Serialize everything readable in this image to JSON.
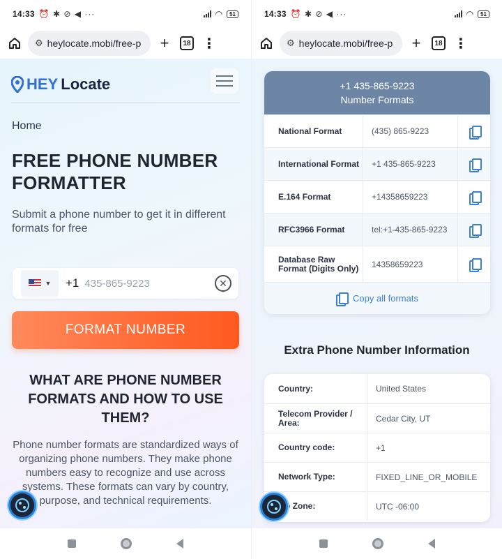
{
  "status_bar": {
    "time": "14:33",
    "status_icons": "⏰ ✱ ⊘ ◀ ···",
    "battery": "51"
  },
  "browser": {
    "url": "heylocate.mobi/free-p",
    "tab_count": "18"
  },
  "left": {
    "logo_prefix": "HEY",
    "logo_suffix": "Locate",
    "breadcrumb": "Home",
    "title": "FREE PHONE NUMBER FORMATTER",
    "subtitle": "Submit a phone number to get it in different formats for free",
    "country_code": "+1",
    "phone_placeholder": "435-865-9223",
    "format_button": "FORMAT NUMBER",
    "section_title": "WHAT ARE PHONE NUMBER FORMATS AND HOW TO USE THEM?",
    "section_text": "Phone number formats are standardized ways of organizing phone numbers. They make phone numbers easy to recognize and use across systems. These formats can vary by country, purpose, and technical requirements."
  },
  "right": {
    "formats_header_number": "+1 435-865-9223",
    "formats_header_title": "Number Formats",
    "formats": [
      {
        "label": "National Format",
        "value": "(435) 865-9223"
      },
      {
        "label": "International Format",
        "value": "+1 435-865-9223"
      },
      {
        "label": "E.164 Format",
        "value": "+14358659223"
      },
      {
        "label": "RFC3966 Format",
        "value": "tel:+1-435-865-9223"
      },
      {
        "label": "Database Raw Format (Digits Only)",
        "value": "14358659223"
      }
    ],
    "copy_all": "Copy all formats",
    "extra_title": "Extra Phone Number Information",
    "info": [
      {
        "label": "Country:",
        "value": "United States"
      },
      {
        "label": "Telecom Provider / Area:",
        "value": "Cedar City, UT"
      },
      {
        "label": "Country code:",
        "value": "+1"
      },
      {
        "label": "Network Type:",
        "value": "FIXED_LINE_OR_MOBILE"
      },
      {
        "label": "me Zone:",
        "value": "UTC -06:00"
      }
    ]
  }
}
